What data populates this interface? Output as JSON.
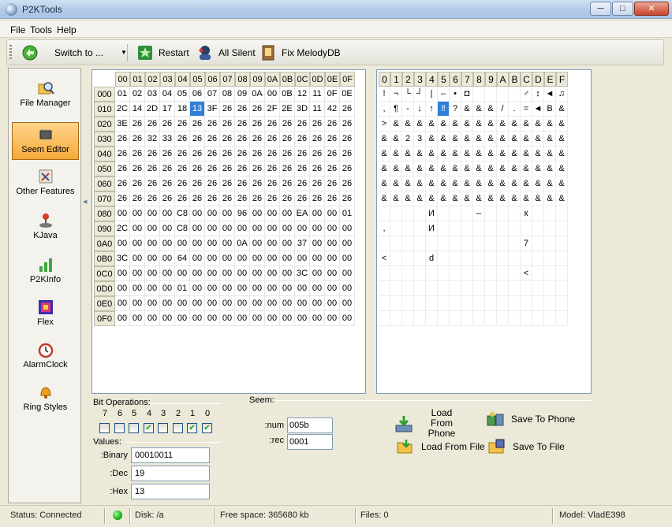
{
  "window": {
    "title": "P2KTools"
  },
  "menu": [
    "File",
    "Tools",
    "Help"
  ],
  "toolbar": {
    "switch_label": "Switch to ...",
    "restart": "Restart",
    "all_silent": "All Silent",
    "fix_melody": "Fix MelodyDB"
  },
  "sidebar": [
    {
      "label": "File Manager",
      "icon": "magnifier-folder-icon"
    },
    {
      "label": "Seem Editor",
      "icon": "chip-icon",
      "active": true
    },
    {
      "label": "Other Features",
      "icon": "tools-icon"
    },
    {
      "label": "KJava",
      "icon": "joystick-icon"
    },
    {
      "label": "P2KInfo",
      "icon": "signal-bars-icon"
    },
    {
      "label": "Flex",
      "icon": "flex-icon"
    },
    {
      "label": "AlarmClock",
      "icon": "alarm-clock-icon"
    },
    {
      "label": "Ring Styles",
      "icon": "bell-icon"
    }
  ],
  "hex": {
    "columns": [
      "00",
      "01",
      "02",
      "03",
      "04",
      "05",
      "06",
      "07",
      "08",
      "09",
      "0A",
      "0B",
      "0C",
      "0D",
      "0E",
      "0F"
    ],
    "rows": [
      {
        "addr": "000",
        "cells": [
          "01",
          "02",
          "03",
          "04",
          "05",
          "06",
          "07",
          "08",
          "09",
          "0A",
          "00",
          "0B",
          "12",
          "11",
          "0F",
          "0E"
        ]
      },
      {
        "addr": "010",
        "cells": [
          "2C",
          "14",
          "2D",
          "17",
          "18",
          "13",
          "3F",
          "26",
          "26",
          "26",
          "2F",
          "2E",
          "3D",
          "11",
          "42",
          "26"
        ]
      },
      {
        "addr": "020",
        "cells": [
          "3E",
          "26",
          "26",
          "26",
          "26",
          "26",
          "26",
          "26",
          "26",
          "26",
          "26",
          "26",
          "26",
          "26",
          "26",
          "26"
        ]
      },
      {
        "addr": "030",
        "cells": [
          "26",
          "26",
          "32",
          "33",
          "26",
          "26",
          "26",
          "26",
          "26",
          "26",
          "26",
          "26",
          "26",
          "26",
          "26",
          "26"
        ]
      },
      {
        "addr": "040",
        "cells": [
          "26",
          "26",
          "26",
          "26",
          "26",
          "26",
          "26",
          "26",
          "26",
          "26",
          "26",
          "26",
          "26",
          "26",
          "26",
          "26"
        ]
      },
      {
        "addr": "050",
        "cells": [
          "26",
          "26",
          "26",
          "26",
          "26",
          "26",
          "26",
          "26",
          "26",
          "26",
          "26",
          "26",
          "26",
          "26",
          "26",
          "26"
        ]
      },
      {
        "addr": "060",
        "cells": [
          "26",
          "26",
          "26",
          "26",
          "26",
          "26",
          "26",
          "26",
          "26",
          "26",
          "26",
          "26",
          "26",
          "26",
          "26",
          "26"
        ]
      },
      {
        "addr": "070",
        "cells": [
          "26",
          "26",
          "26",
          "26",
          "26",
          "26",
          "26",
          "26",
          "26",
          "26",
          "26",
          "26",
          "26",
          "26",
          "26",
          "26"
        ]
      },
      {
        "addr": "080",
        "cells": [
          "00",
          "00",
          "00",
          "00",
          "C8",
          "00",
          "00",
          "00",
          "96",
          "00",
          "00",
          "00",
          "EA",
          "00",
          "00",
          "01"
        ]
      },
      {
        "addr": "090",
        "cells": [
          "2C",
          "00",
          "00",
          "00",
          "C8",
          "00",
          "00",
          "00",
          "00",
          "00",
          "00",
          "00",
          "00",
          "00",
          "00",
          "00"
        ]
      },
      {
        "addr": "0A0",
        "cells": [
          "00",
          "00",
          "00",
          "00",
          "00",
          "00",
          "00",
          "00",
          "0A",
          "00",
          "00",
          "00",
          "37",
          "00",
          "00",
          "00"
        ]
      },
      {
        "addr": "0B0",
        "cells": [
          "3C",
          "00",
          "00",
          "00",
          "64",
          "00",
          "00",
          "00",
          "00",
          "00",
          "00",
          "00",
          "00",
          "00",
          "00",
          "00"
        ]
      },
      {
        "addr": "0C0",
        "cells": [
          "00",
          "00",
          "00",
          "00",
          "00",
          "00",
          "00",
          "00",
          "00",
          "00",
          "00",
          "00",
          "3C",
          "00",
          "00",
          "00"
        ]
      },
      {
        "addr": "0D0",
        "cells": [
          "00",
          "00",
          "00",
          "00",
          "01",
          "00",
          "00",
          "00",
          "00",
          "00",
          "00",
          "00",
          "00",
          "00",
          "00",
          "00"
        ]
      },
      {
        "addr": "0E0",
        "cells": [
          "00",
          "00",
          "00",
          "00",
          "00",
          "00",
          "00",
          "00",
          "00",
          "00",
          "00",
          "00",
          "00",
          "00",
          "00",
          "00"
        ]
      },
      {
        "addr": "0F0",
        "cells": [
          "00",
          "00",
          "00",
          "00",
          "00",
          "00",
          "00",
          "00",
          "00",
          "00",
          "00",
          "00",
          "00",
          "00",
          "00",
          "00"
        ]
      }
    ],
    "selected": {
      "row": 1,
      "col": 5
    }
  },
  "chars": {
    "columns": [
      "0",
      "1",
      "2",
      "3",
      "4",
      "5",
      "6",
      "7",
      "8",
      "9",
      "A",
      "B",
      "C",
      "D",
      "E",
      "F"
    ],
    "rows": [
      [
        "!",
        "¬",
        "└",
        "┘",
        "|",
        "–",
        "•",
        "◘",
        "",
        "",
        "",
        "",
        "♂",
        "↕",
        "◄",
        "♫"
      ],
      [
        ",",
        "¶",
        "-",
        "↓",
        "↑",
        "‼",
        "?",
        "&",
        "&",
        "&",
        "/",
        ".",
        "=",
        "◄",
        "B",
        "&"
      ],
      [
        ">",
        "&",
        "&",
        "&",
        "&",
        "&",
        "&",
        "&",
        "&",
        "&",
        "&",
        "&",
        "&",
        "&",
        "&",
        "&"
      ],
      [
        "&",
        "&",
        "2",
        "3",
        "&",
        "&",
        "&",
        "&",
        "&",
        "&",
        "&",
        "&",
        "&",
        "&",
        "&",
        "&"
      ],
      [
        "&",
        "&",
        "&",
        "&",
        "&",
        "&",
        "&",
        "&",
        "&",
        "&",
        "&",
        "&",
        "&",
        "&",
        "&",
        "&"
      ],
      [
        "&",
        "&",
        "&",
        "&",
        "&",
        "&",
        "&",
        "&",
        "&",
        "&",
        "&",
        "&",
        "&",
        "&",
        "&",
        "&"
      ],
      [
        "&",
        "&",
        "&",
        "&",
        "&",
        "&",
        "&",
        "&",
        "&",
        "&",
        "&",
        "&",
        "&",
        "&",
        "&",
        "&"
      ],
      [
        "&",
        "&",
        "&",
        "&",
        "&",
        "&",
        "&",
        "&",
        "&",
        "&",
        "&",
        "&",
        "&",
        "&",
        "&",
        "&"
      ],
      [
        "",
        "",
        "",
        "",
        "И",
        "",
        "",
        "",
        "–",
        "",
        "",
        "",
        "к",
        "",
        "",
        ""
      ],
      [
        ",",
        "",
        "",
        "",
        "И",
        "",
        "",
        "",
        "",
        "",
        "",
        "",
        "",
        "",
        "",
        ""
      ],
      [
        "",
        "",
        "",
        "",
        "",
        "",
        "",
        "",
        "",
        "",
        "",
        "",
        "7",
        "",
        "",
        ""
      ],
      [
        "<",
        "",
        "",
        "",
        "d",
        "",
        "",
        "",
        "",
        "",
        "",
        "",
        "",
        "",
        "",
        ""
      ],
      [
        "",
        "",
        "",
        "",
        "",
        "",
        "",
        "",
        "",
        "",
        "",
        "",
        "<",
        "",
        "",
        ""
      ],
      [
        "",
        "",
        "",
        "",
        "",
        "",
        "",
        "",
        "",
        "",
        "",
        "",
        "",
        "",
        "",
        ""
      ],
      [
        "",
        "",
        "",
        "",
        "",
        "",
        "",
        "",
        "",
        "",
        "",
        "",
        "",
        "",
        "",
        ""
      ],
      [
        "",
        "",
        "",
        "",
        "",
        "",
        "",
        "",
        "",
        "",
        "",
        "",
        "",
        "",
        "",
        ""
      ]
    ],
    "selected": {
      "row": 1,
      "col": 5
    }
  },
  "bit_operations": {
    "label": "Bit Operations:",
    "bits": [
      "7",
      "6",
      "5",
      "4",
      "3",
      "2",
      "1",
      "0"
    ],
    "checked": [
      false,
      false,
      false,
      true,
      false,
      false,
      true,
      true
    ]
  },
  "values": {
    "label": "Values:",
    "binary_label": ":Binary",
    "binary": "00010011",
    "dec_label": ":Dec",
    "dec": "19",
    "hex_label": ":Hex",
    "hex": "13"
  },
  "seem": {
    "label": "Seem:",
    "num_label": ":num",
    "num": "005b",
    "rec_label": ":rec",
    "rec": "0001"
  },
  "actions": {
    "load_phone": "Load From Phone",
    "save_phone": "Save To Phone",
    "load_file": "Load From File",
    "save_file": "Save To File"
  },
  "status": {
    "connection": "Status: Connected",
    "disk": "Disk: /a",
    "free_space": "Free space: 365680 kb",
    "files": "Files: 0",
    "model": "Model: VladE398"
  }
}
